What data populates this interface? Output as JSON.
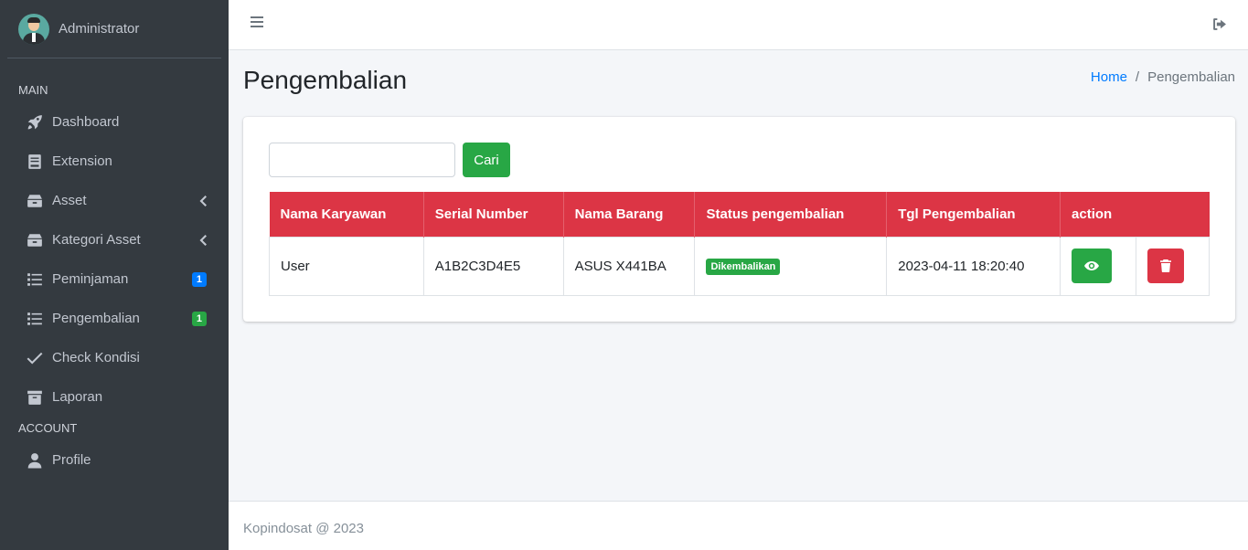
{
  "user": {
    "name": "Administrator"
  },
  "sidebar": {
    "main_header": "MAIN",
    "account_header": "ACCOUNT",
    "items": [
      {
        "label": "Dashboard",
        "icon": "rocket-icon"
      },
      {
        "label": "Extension",
        "icon": "book-icon"
      },
      {
        "label": "Asset",
        "icon": "box-icon",
        "chevron": true
      },
      {
        "label": "Kategori Asset",
        "icon": "box-icon",
        "chevron": true
      },
      {
        "label": "Peminjaman",
        "icon": "list-icon",
        "badge": "1",
        "badge_color": "#007bff"
      },
      {
        "label": "Pengembalian",
        "icon": "list-icon",
        "badge": "1",
        "badge_color": "#28a745"
      },
      {
        "label": "Check Kondisi",
        "icon": "check-icon"
      },
      {
        "label": "Laporan",
        "icon": "archive-icon"
      }
    ],
    "account_items": [
      {
        "label": "Profile",
        "icon": "user-icon"
      }
    ]
  },
  "header": {
    "title": "Pengembalian",
    "breadcrumb": {
      "home": "Home",
      "current": "Pengembalian"
    }
  },
  "search": {
    "value": "",
    "placeholder": "",
    "button_label": "Cari"
  },
  "table": {
    "columns": [
      "Nama Karyawan",
      "Serial Number",
      "Nama Barang",
      "Status pengembalian",
      "Tgl Pengembalian",
      "action"
    ],
    "rows": [
      {
        "nama_karyawan": "User",
        "serial_number": "A1B2C3D4E5",
        "nama_barang": "ASUS X441BA",
        "status": "Dikembalikan",
        "tgl": "2023-04-11 18:20:40"
      }
    ]
  },
  "footer": {
    "text": "Kopindosat @ 2023"
  },
  "colors": {
    "sidebar_bg": "#343a40",
    "accent_red": "#dc3545",
    "accent_green": "#28a745",
    "accent_blue": "#007bff"
  }
}
